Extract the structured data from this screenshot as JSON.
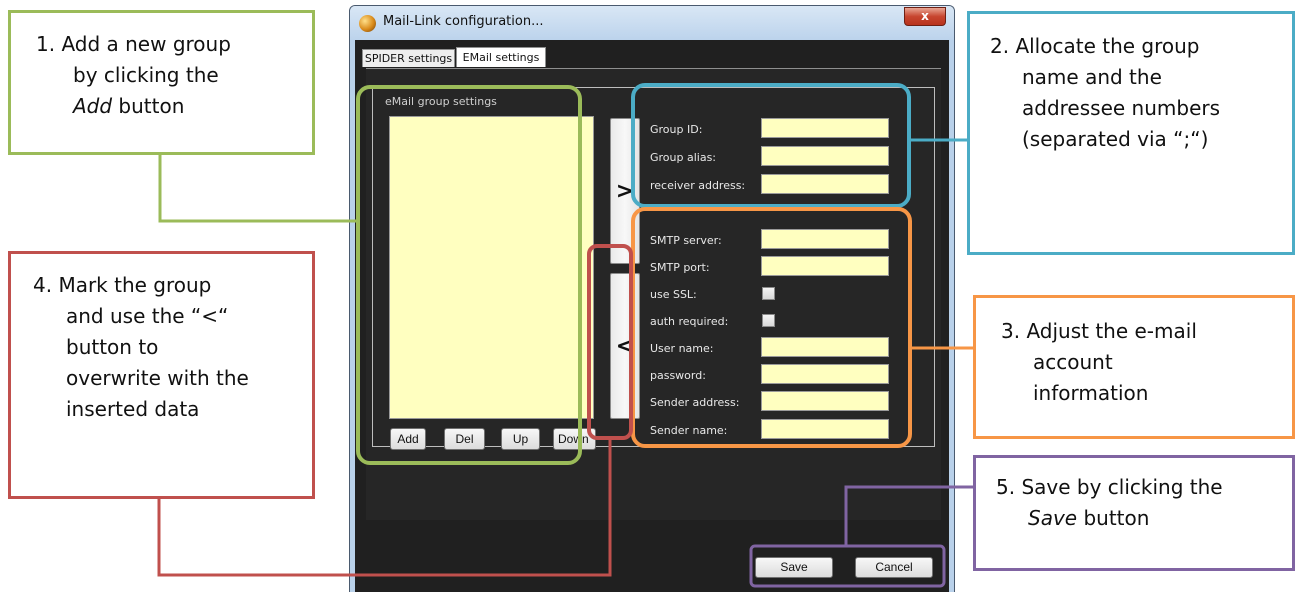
{
  "window": {
    "title": "Mail-Link configuration...",
    "close_label": "x",
    "tabs": [
      {
        "label": "SPIDER settings",
        "active": false
      },
      {
        "label": "EMail settings",
        "active": true
      }
    ],
    "group_box_label": "eMail group settings",
    "list_buttons": [
      "Add",
      "Del",
      "Up",
      "Down"
    ],
    "transfer_right_label": ">",
    "transfer_left_label": "<",
    "group_fields": [
      {
        "label": "Group ID:",
        "value": ""
      },
      {
        "label": "Group alias:",
        "value": ""
      },
      {
        "label": "receiver address:",
        "value": ""
      }
    ],
    "account_fields": [
      {
        "label": "SMTP server:",
        "type": "text",
        "value": ""
      },
      {
        "label": "SMTP port:",
        "type": "text",
        "value": ""
      },
      {
        "label": "use SSL:",
        "type": "checkbox",
        "checked": false
      },
      {
        "label": "auth required:",
        "type": "checkbox",
        "checked": false
      },
      {
        "label": "User name:",
        "type": "text",
        "value": ""
      },
      {
        "label": "password:",
        "type": "text",
        "value": ""
      },
      {
        "label": "Sender address:",
        "type": "text",
        "value": ""
      },
      {
        "label": "Sender name:",
        "type": "text",
        "value": ""
      }
    ],
    "footer_buttons": {
      "save": "Save",
      "cancel": "Cancel"
    }
  },
  "callouts": {
    "c1": {
      "lines": [
        {
          "text": "1.  Add a new group"
        },
        {
          "text": "by clicking the"
        },
        {
          "text": "Add",
          "italic": true,
          "rest": " button"
        }
      ]
    },
    "c2": {
      "lines": [
        {
          "text": "2.  Allocate the group"
        },
        {
          "text": "name and the"
        },
        {
          "text": "addressee numbers"
        },
        {
          "text": "(separated via  “;“)"
        }
      ]
    },
    "c3": {
      "lines": [
        {
          "text": "3.  Adjust the e-mail"
        },
        {
          "text": "account"
        },
        {
          "text": "information"
        }
      ]
    },
    "c4": {
      "lines": [
        {
          "text": "4.  Mark the group"
        },
        {
          "text": "and use the “<“"
        },
        {
          "text": "button to"
        },
        {
          "text": "overwrite with the"
        },
        {
          "text": "inserted data"
        }
      ]
    },
    "c5": {
      "lines": [
        {
          "text": "5.  Save by clicking the"
        },
        {
          "text": "Save",
          "italic": true,
          "rest": " button"
        }
      ]
    }
  },
  "colors": {
    "green": "#9bbb59",
    "blue": "#4bacc6",
    "orange": "#f79646",
    "red": "#c0504d",
    "purple": "#8064a2",
    "input_fill": "#ffffc0",
    "dark_background": "#202020"
  },
  "icons": {
    "app": "mail-link-app-icon",
    "close": "close-icon"
  }
}
